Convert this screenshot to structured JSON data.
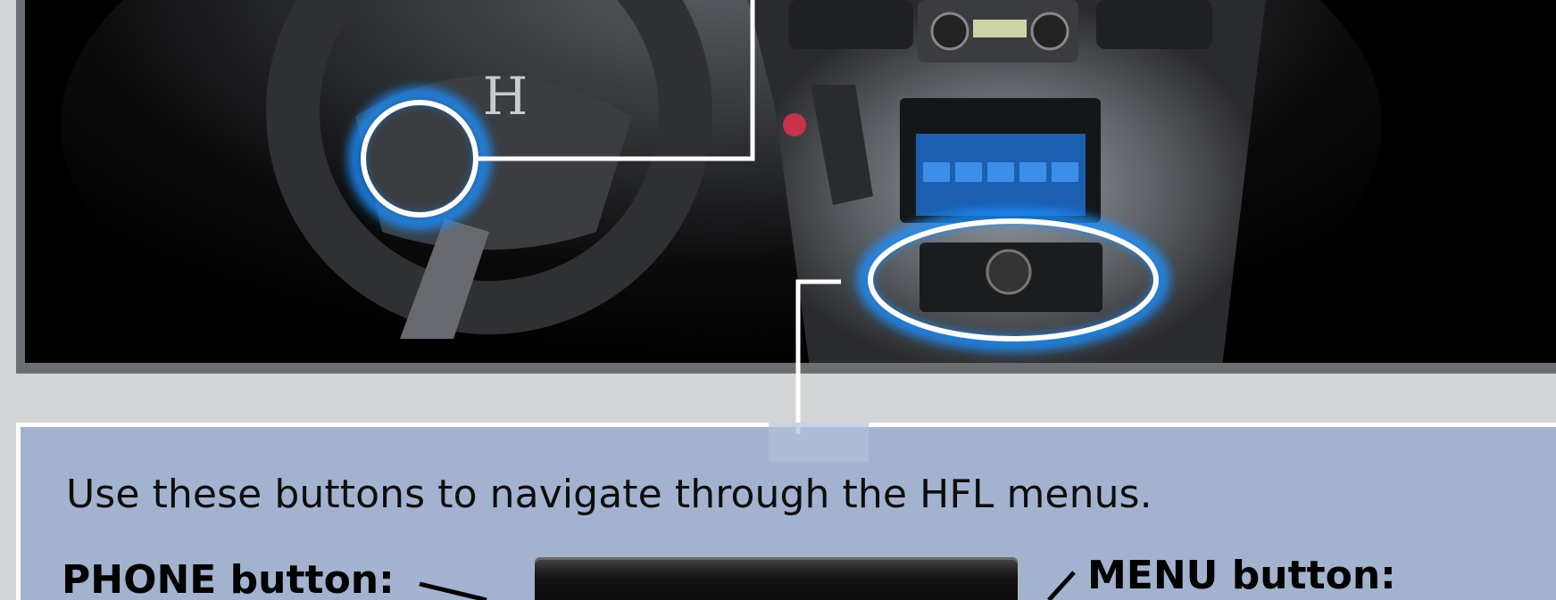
{
  "intro_text": "Use these buttons to navigate through the HFL menus.",
  "phone_label": "PHONE button:",
  "menu_label": "MENU button:",
  "steering_logo": "H",
  "colors": {
    "panel_background": "#a3b3cf",
    "page_background": "#d3d4d6",
    "highlight_glow": "#1e90ff"
  }
}
